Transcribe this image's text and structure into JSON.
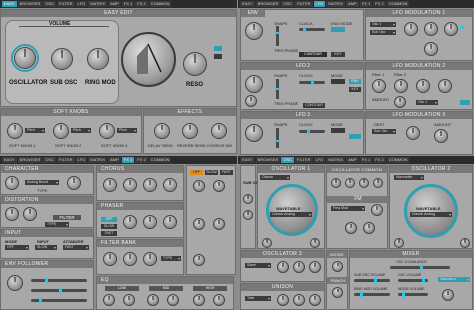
{
  "top_tabs": [
    "EASY",
    "BROWSER",
    "OSC",
    "FILTER",
    "LFO",
    "MATRIX",
    "AMP",
    "FX 1",
    "FX 2",
    "COMMON"
  ],
  "top_tabs_right": [
    "EASY",
    "BROWSER",
    "OSC",
    "FILTER",
    "LFO",
    "MATRIX",
    "AMP",
    "FX 1",
    "FX 2",
    "COMMON"
  ],
  "mid_tabs": [
    "EASY",
    "BROWSER",
    "OSC",
    "FILTER",
    "LFO",
    "MATRIX",
    "AMP",
    "FX 1",
    "FX 2",
    "COMMON"
  ],
  "mid_tabs_right": [
    "EASY",
    "BROWSER",
    "OSC",
    "FILTER",
    "LFO",
    "MATRIX",
    "AMP",
    "FX 1",
    "FX 2",
    "COMMON"
  ],
  "easy_edit": {
    "title": "EASY EDIT",
    "volume": "VOLUME",
    "oscillator": "OSCILLATOR",
    "sub_osc": "SUB OSC",
    "ring_mod": "RING MOD",
    "reso": "RESO",
    "soft_knobs": "SOFT KNOBS",
    "effects": "EFFECTS",
    "soft1": "SOFT KNOB 1",
    "soft2": "SOFT KNOB 2",
    "soft3": "SOFT KNOB 3",
    "sk_sel1": "Pitch",
    "sk_sel2": "Pitch",
    "sk_sel3": "Pitch",
    "delay": "DELAY SEND",
    "reverb": "REVERB SEND",
    "chorus": "CHORUS MIX"
  },
  "lfo_page": {
    "env": "ENV",
    "contour": "CONTOUR",
    "lfo1": "LFO 1",
    "lfo2": "LFO 2",
    "lfo3": "LFO 3",
    "mod1": "LFO MODULATION 1",
    "mod2": "LFO MODULATION 2",
    "mod3": "LFO MODULATION 3",
    "mode": "MODE",
    "shape": "SHAPE",
    "clock": "CLOCK",
    "rate": "RATE",
    "trig": "TRIG PHASE",
    "env_mode": "ENV MODE",
    "key": "KEY",
    "amount": "AMOUNT",
    "dest": "DEST",
    "fil1": "Filter 1",
    "fil2": "Filter 2",
    "osc_val": "Osc 1",
    "sub_osc_val": "Sub Osc"
  },
  "osc_page": {
    "character": "CHARACTER",
    "distortion": "DISTORTION",
    "filter": "FILTER",
    "input": "INPUT",
    "mode": "MODE",
    "atomizer": "ATOMIZER",
    "env_follower": "ENV FOLLOWER",
    "chorus": "CHORUS",
    "phaser": "PHASER",
    "filter_bank": "FILTER BANK",
    "eq": "EQ",
    "low": "LOW",
    "mid": "MID",
    "high": "HIGH",
    "analog_boost": "Analog Boost",
    "type": "TYPE",
    "fx_order": [
      "OFF",
      "SLOW",
      "FAST"
    ]
  },
  "osc_right": {
    "osc1": "OSCILLATOR 1",
    "osc2": "OSCILLATOR 2",
    "osc_common": "OSCILLATOR COMMON",
    "osc3": "OSCILLATOR 3",
    "unison": "UNISON",
    "noise": "NOISE",
    "mixer": "MIXER",
    "sub_osc": "SUB OSC",
    "wavetable": "WAVETABLE",
    "fm": "FM",
    "punch": "PUNCH",
    "wavetable_val": "Classic Analog",
    "osc1_mode": "Classic",
    "osc2_mode": "Wavetable",
    "osc3_mode": "Slave",
    "unison_mode": "Twin",
    "fm_mode": "Freq Mod",
    "osc_balance": "OSC 1/2 BALANCE",
    "sub_osc_vol": "SUB OSC VOLUME",
    "osc_vol": "OSC VOLUME",
    "ring_vol": "RING MOD VOLUME",
    "noise_vol": "NOISE VOLUME",
    "detune": "DETUNE",
    "pan": "PAN SPREAD",
    "sel_val": "Saturation"
  }
}
